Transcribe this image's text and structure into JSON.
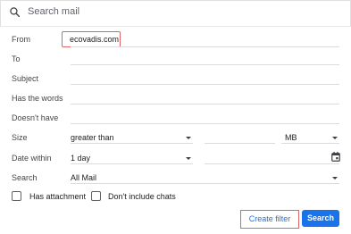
{
  "search": {
    "placeholder": "Search mail",
    "icon": "search-icon"
  },
  "form": {
    "from_label": "From",
    "from_value": "ecovadis.com",
    "to_label": "To",
    "subject_label": "Subject",
    "has_words_label": "Has the words",
    "doesnt_have_label": "Doesn't have",
    "size_label": "Size",
    "size_operator": "greater than",
    "size_unit": "MB",
    "date_within_label": "Date within",
    "date_within_value": "1 day",
    "search_scope_label": "Search",
    "search_scope_value": "All Mail",
    "has_attachment_label": "Has attachment",
    "no_chats_label": "Don't include chats"
  },
  "buttons": {
    "create_filter": "Create filter",
    "search": "Search"
  },
  "colors": {
    "primary": "#1a73e8",
    "highlight_border": "#e06666"
  }
}
